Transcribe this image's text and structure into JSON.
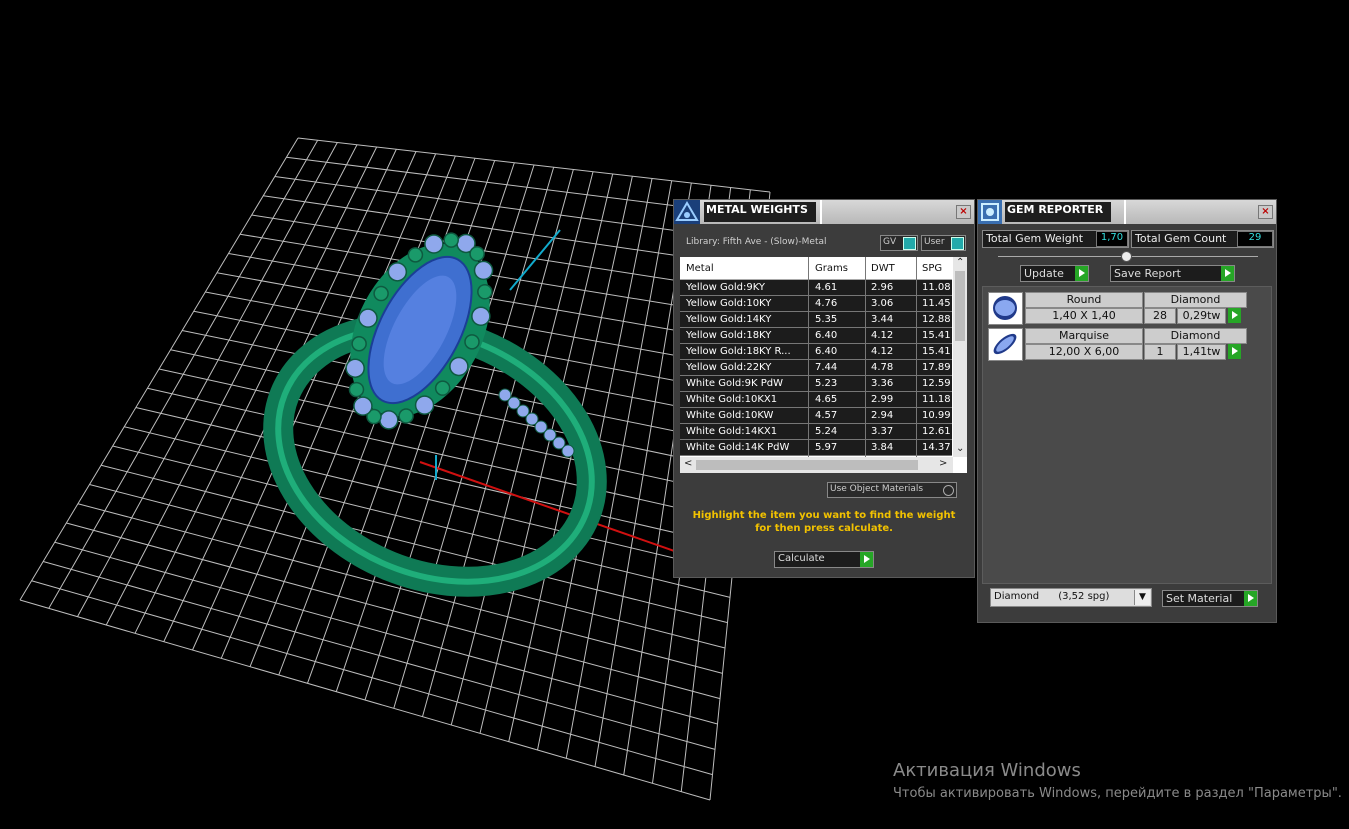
{
  "metal_weights": {
    "title": "METAL WEIGHTS",
    "library": "Library: Fifth Ave - (Slow)-Metal",
    "toggle_gv": "GV",
    "toggle_user": "User",
    "columns": [
      "Metal",
      "Grams",
      "DWT",
      "SPG"
    ],
    "rows": [
      [
        "Yellow Gold:9KY",
        "4.61",
        "2.96",
        "11.08"
      ],
      [
        "Yellow Gold:10KY",
        "4.76",
        "3.06",
        "11.45"
      ],
      [
        "Yellow Gold:14KY",
        "5.35",
        "3.44",
        "12.88"
      ],
      [
        "Yellow Gold:18KY",
        "6.40",
        "4.12",
        "15.41"
      ],
      [
        "Yellow Gold:18KY R...",
        "6.40",
        "4.12",
        "15.41"
      ],
      [
        "Yellow Gold:22KY",
        "7.44",
        "4.78",
        "17.89"
      ],
      [
        "White Gold:9K PdW",
        "5.23",
        "3.36",
        "12.59"
      ],
      [
        "White Gold:10KX1",
        "4.65",
        "2.99",
        "11.18"
      ],
      [
        "White Gold:10KW",
        "4.57",
        "2.94",
        "10.99"
      ],
      [
        "White Gold:14KX1",
        "5.24",
        "3.37",
        "12.61"
      ],
      [
        "White Gold:14K PdW",
        "5.97",
        "3.84",
        "14.37"
      ]
    ],
    "use_object_materials": "Use Object Materials",
    "hint_line1": "Highlight the item you want to find the weight",
    "hint_line2": "for then press calculate.",
    "calculate": "Calculate"
  },
  "gem_reporter": {
    "title": "GEM REPORTER",
    "total_weight_label": "Total Gem Weight",
    "total_weight_value": "1,70",
    "total_count_label": "Total Gem Count",
    "total_count_value": "29",
    "update": "Update",
    "save_report": "Save Report",
    "gems": [
      {
        "shape": "Round",
        "material": "Diamond",
        "size": "1,40 X 1,40",
        "count": "28",
        "weight": "0,29tw"
      },
      {
        "shape": "Marquise",
        "material": "Diamond",
        "size": "12,00 X 6,00",
        "count": "1",
        "weight": "1,41tw"
      }
    ],
    "material_select": "Diamond      (3,52 spg)",
    "set_material": "Set Material"
  },
  "watermark": {
    "line1": "Активация Windows",
    "line2": "Чтобы активировать Windows, перейдите в раздел \"Параметры\"."
  }
}
